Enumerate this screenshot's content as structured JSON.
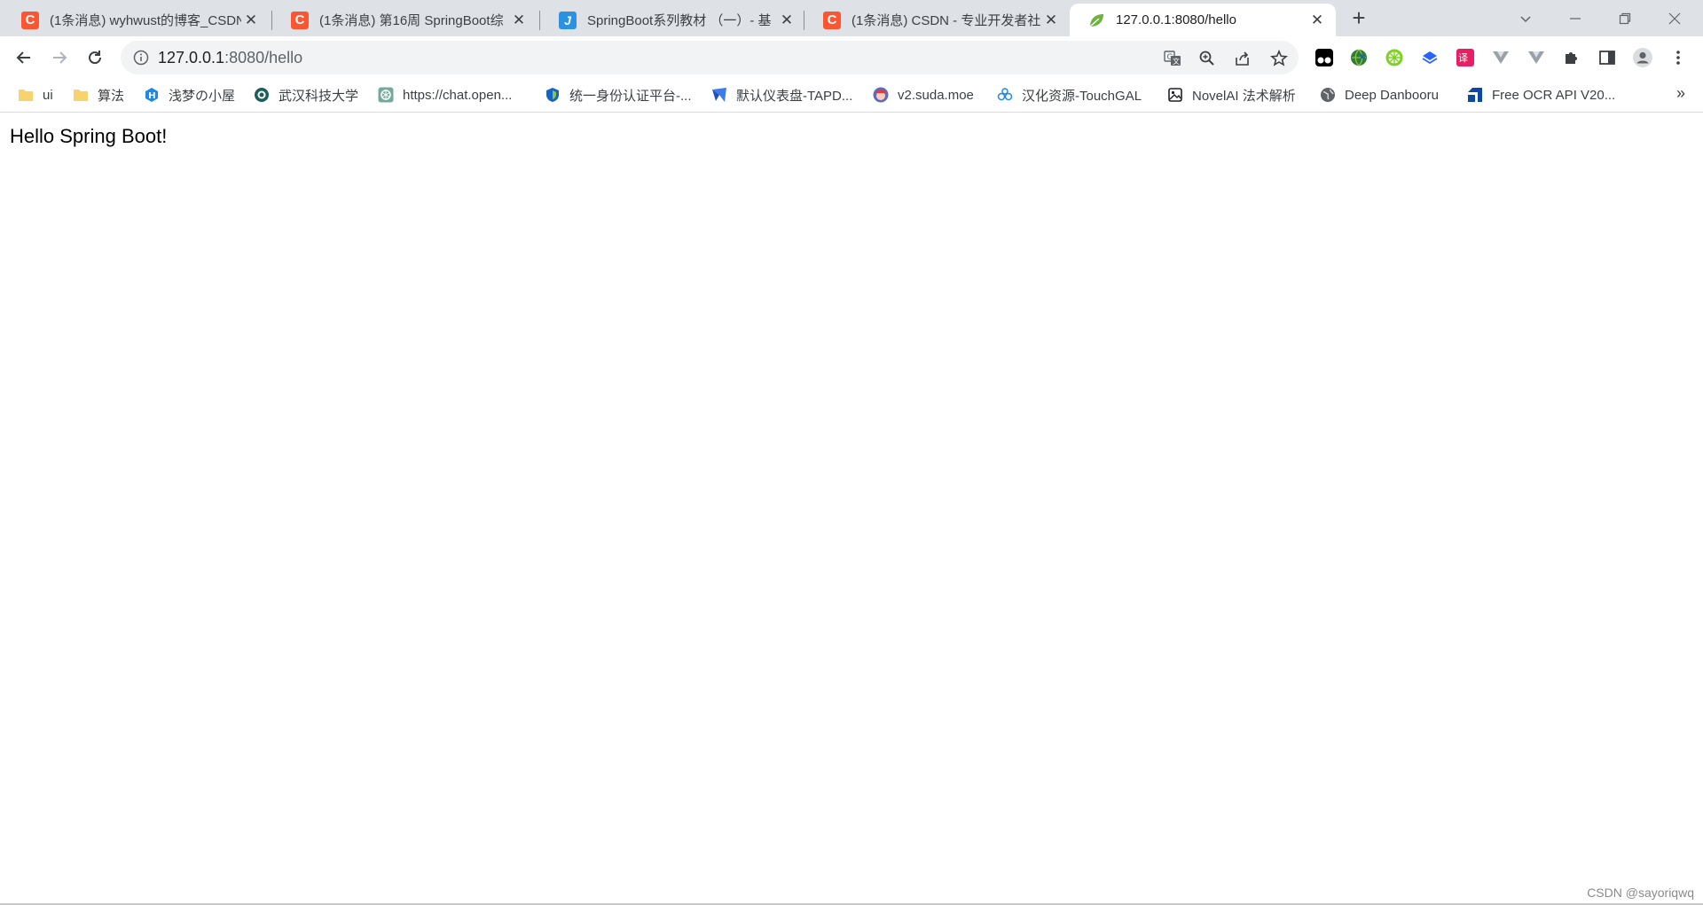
{
  "tabs": [
    {
      "title": "(1条消息) wyhwust的博客_CSDN",
      "favicon": "csdn-icon",
      "active": false
    },
    {
      "title": "(1条消息) 第16周 SpringBoot综",
      "favicon": "csdn-icon",
      "active": false
    },
    {
      "title": "SpringBoot系列教材 （一）- 基",
      "favicon": "j-icon",
      "active": false
    },
    {
      "title": "(1条消息) CSDN - 专业开发者社",
      "favicon": "csdn-icon",
      "active": false
    },
    {
      "title": "127.0.0.1:8080/hello",
      "favicon": "spring-leaf-icon",
      "active": true
    }
  ],
  "address_bar": {
    "host": "127.0.0.1",
    "rest": ":8080/hello"
  },
  "bookmarks": [
    {
      "label": "ui",
      "icon": "folder-icon"
    },
    {
      "label": "算法",
      "icon": "folder-icon"
    },
    {
      "label": "浅梦の小屋",
      "icon": "h-icon"
    },
    {
      "label": "武汉科技大学",
      "icon": "university-icon"
    },
    {
      "label": "https://chat.open...",
      "icon": "openai-icon"
    },
    {
      "label": "统一身份认证平台-...",
      "icon": "shield-icon"
    },
    {
      "label": "默认仪表盘-TAPD...",
      "icon": "tapd-icon"
    },
    {
      "label": "v2.suda.moe",
      "icon": "avatar-icon"
    },
    {
      "label": "汉化资源-TouchGAL",
      "icon": "touchgal-icon"
    },
    {
      "label": "NovelAI 法术解析",
      "icon": "image-icon"
    },
    {
      "label": "Deep Danbooru",
      "icon": "globe-icon"
    },
    {
      "label": "Free OCR API V20...",
      "icon": "ocr-icon"
    }
  ],
  "page": {
    "text": "Hello Spring Boot!"
  },
  "watermark": "CSDN @sayoriqwq",
  "colors": {
    "tabstrip": "#dee1e6",
    "csdn": "#fc5531",
    "spring": "#6db33f"
  }
}
